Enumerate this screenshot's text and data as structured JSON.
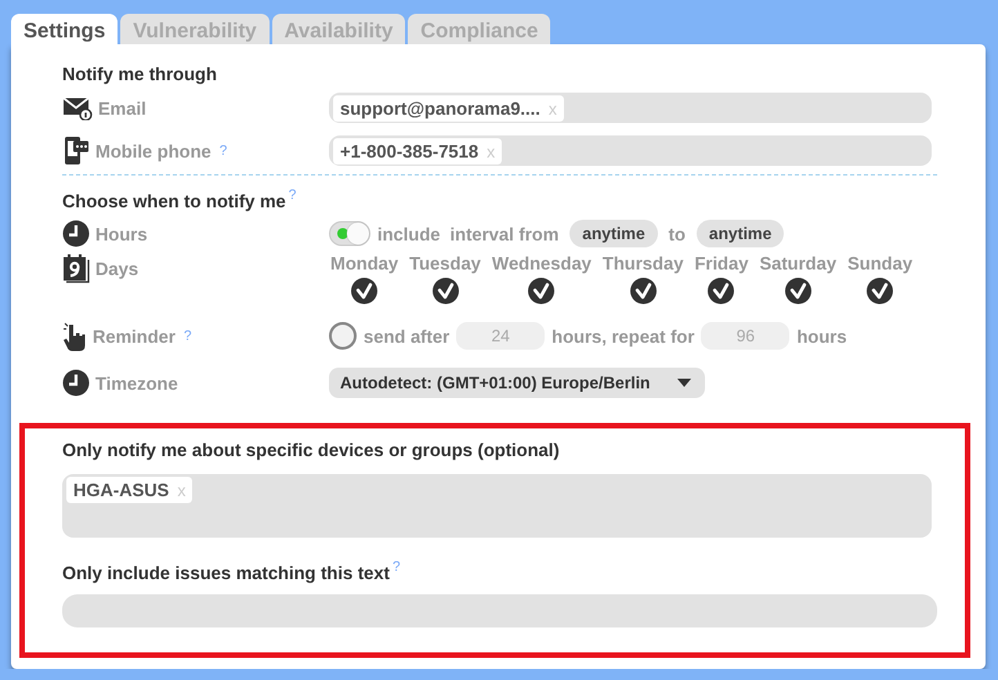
{
  "tabs": [
    {
      "label": "Settings",
      "selected": true
    },
    {
      "label": "Vulnerability",
      "selected": false
    },
    {
      "label": "Availability",
      "selected": false
    },
    {
      "label": "Compliance",
      "selected": false
    }
  ],
  "notify_through": {
    "heading": "Notify me through",
    "channels": [
      {
        "kind": "email",
        "label": "Email",
        "tags": [
          {
            "text": "support@panorama9....",
            "remove": "x"
          }
        ]
      },
      {
        "kind": "phone",
        "label": "Mobile phone",
        "help": "?",
        "tags": [
          {
            "text": "+1-800-385-7518",
            "remove": "x"
          }
        ]
      }
    ]
  },
  "schedule": {
    "heading": "Choose when to notify me",
    "help": "?",
    "hours": {
      "label": "Hours",
      "on": true,
      "include": "include",
      "from_text": "interval from",
      "from": "anytime",
      "to_text": "to",
      "to": "anytime"
    },
    "days": {
      "label": "Days",
      "items": [
        {
          "name": "Monday",
          "checked": true
        },
        {
          "name": "Tuesday",
          "checked": true
        },
        {
          "name": "Wednesday",
          "checked": true
        },
        {
          "name": "Thursday",
          "checked": true
        },
        {
          "name": "Friday",
          "checked": true
        },
        {
          "name": "Saturday",
          "checked": true
        },
        {
          "name": "Sunday",
          "checked": true
        }
      ]
    },
    "reminder": {
      "label": "Reminder",
      "help": "?",
      "checked": false,
      "send_after": "send after",
      "after_placeholder": "24",
      "repeat_text": "hours, repeat for",
      "repeat_placeholder": "96",
      "hours_text": "hours"
    },
    "timezone": {
      "label": "Timezone",
      "value": "Autodetect: (GMT+01:00) Europe/Berlin"
    }
  },
  "filters": {
    "highlighted": true,
    "devices": {
      "label": "Only notify me about specific devices or groups (optional)",
      "tags": [
        {
          "text": "HGA-ASUS",
          "remove": "x"
        }
      ]
    },
    "text_filter": {
      "label": "Only include issues matching this text",
      "help": "?"
    }
  }
}
